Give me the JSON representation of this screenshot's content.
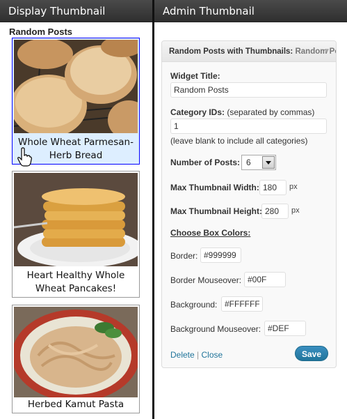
{
  "header": {
    "left_title": "Display Thumbnail",
    "right_title": "Admin Thumbnail"
  },
  "display": {
    "title": "Random Posts",
    "posts": [
      {
        "caption_line1": "Whole Wheat Parmesan-",
        "caption_line2": "Herb Bread"
      },
      {
        "caption_line1": "Heart Healthy Whole",
        "caption_line2": "Wheat Pancakes!"
      },
      {
        "caption_line1": "Herbed Kamut Pasta"
      }
    ]
  },
  "widget": {
    "header_title": "Random Posts with Thumbnails:",
    "header_subtitle": "Random Posts",
    "widget_title_label": "Widget Title:",
    "widget_title_value": "Random Posts",
    "category_label": "Category IDs:",
    "category_hint": "(separated by commas)",
    "category_value": "1",
    "category_note": "(leave blank to include all categories)",
    "num_posts_label": "Number of Posts:",
    "num_posts_value": "6",
    "max_width_label": "Max Thumbnail Width:",
    "max_width_value": "180",
    "max_height_label": "Max Thumbnail Height:",
    "max_height_value": "280",
    "unit": "px",
    "colors_label": "Choose Box Colors:",
    "border_label": "Border:",
    "border_value": "#999999",
    "border_mouseover_label": "Border Mouseover:",
    "border_mouseover_value": "#00F",
    "background_label": "Background:",
    "background_value": "#FFFFFF",
    "background_mouseover_label": "Background Mouseover:",
    "background_mouseover_value": "#DEF",
    "delete_label": "Delete",
    "separator": " | ",
    "close_label": "Close",
    "save_label": "Save"
  },
  "colors": {
    "border": "#999999",
    "border_mouseover": "#00F",
    "background": "#FFFFFF",
    "background_mouseover": "#DEF",
    "link": "#21759b",
    "save_button": "#21759b"
  },
  "icons": {
    "cursor": "hand-pointer-icon",
    "collapse": "triangle-down-icon",
    "select": "dropdown-arrow-icon"
  }
}
